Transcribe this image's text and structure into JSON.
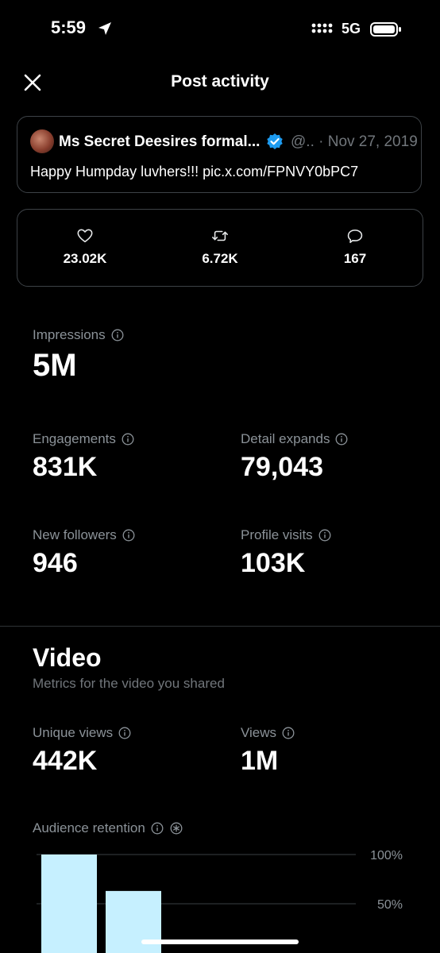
{
  "status_bar": {
    "time": "5:59",
    "network": "5G"
  },
  "header": {
    "title": "Post activity"
  },
  "post": {
    "author_name": "Ms Secret Deesires formal...",
    "handle_date": "@.. · Nov 27, 2019",
    "text": "Happy Humpday luvhers!!! pic.x.com/FPNVY0bPC7"
  },
  "engagement_stats": {
    "likes": "23.02K",
    "reposts": "6.72K",
    "replies": "167"
  },
  "metrics": {
    "impressions": {
      "label": "Impressions",
      "value": "5M"
    },
    "engagements": {
      "label": "Engagements",
      "value": "831K"
    },
    "detail_expands": {
      "label": "Detail expands",
      "value": "79,043"
    },
    "new_followers": {
      "label": "New followers",
      "value": "946"
    },
    "profile_visits": {
      "label": "Profile visits",
      "value": "103K"
    }
  },
  "video": {
    "title": "Video",
    "subtitle": "Metrics for the video you shared",
    "unique_views": {
      "label": "Unique views",
      "value": "442K"
    },
    "views": {
      "label": "Views",
      "value": "1M"
    },
    "retention_label": "Audience retention"
  },
  "chart_data": {
    "type": "bar",
    "title": "Audience retention",
    "categories": [
      "",
      ""
    ],
    "values": [
      100,
      63
    ],
    "y_ticks": [
      "100%",
      "50%"
    ],
    "ylim": [
      0,
      100
    ],
    "bar_color": "#c6f0ff"
  },
  "colors": {
    "background": "#000000",
    "accent": "#1d9bf0",
    "muted": "#71767b"
  }
}
